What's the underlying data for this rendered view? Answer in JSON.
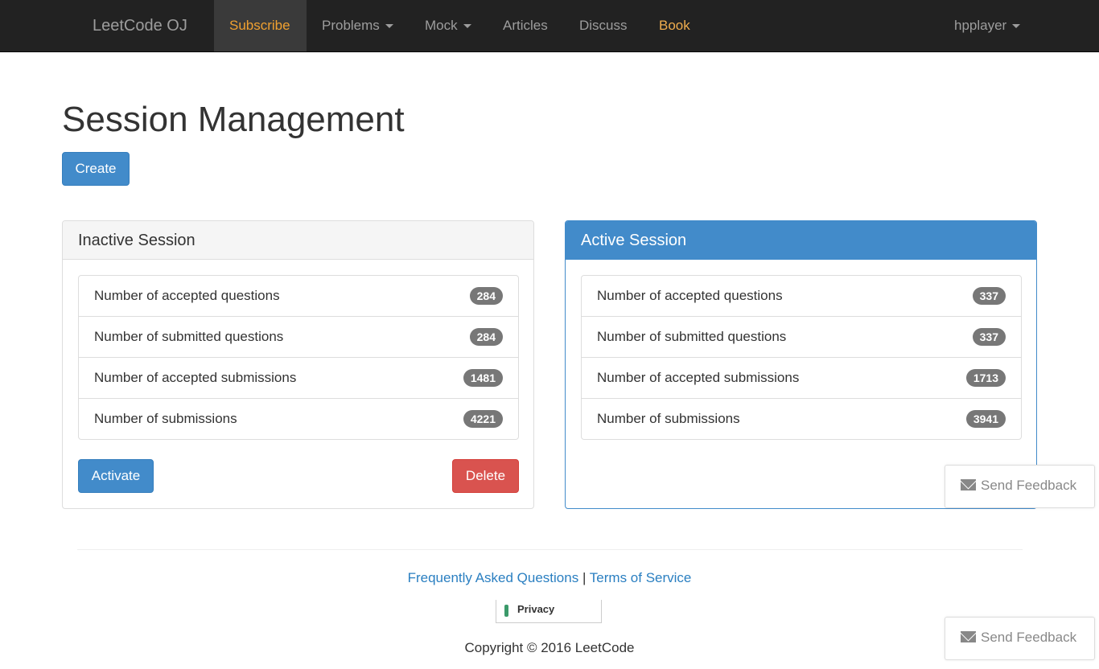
{
  "navbar": {
    "brand": "LeetCode OJ",
    "items": [
      {
        "label": "Subscribe"
      },
      {
        "label": "Problems"
      },
      {
        "label": "Mock"
      },
      {
        "label": "Articles"
      },
      {
        "label": "Discuss"
      },
      {
        "label": "Book"
      }
    ],
    "user": "hpplayer"
  },
  "page": {
    "title": "Session Management",
    "create_label": "Create"
  },
  "inactive": {
    "heading": "Inactive Session",
    "rows": [
      {
        "label": "Number of accepted questions",
        "count": "284"
      },
      {
        "label": "Number of submitted questions",
        "count": "284"
      },
      {
        "label": "Number of accepted submissions",
        "count": "1481"
      },
      {
        "label": "Number of submissions",
        "count": "4221"
      }
    ],
    "activate_label": "Activate",
    "delete_label": "Delete"
  },
  "active": {
    "heading": "Active Session",
    "rows": [
      {
        "label": "Number of accepted questions",
        "count": "337"
      },
      {
        "label": "Number of submitted questions",
        "count": "337"
      },
      {
        "label": "Number of accepted submissions",
        "count": "1713"
      },
      {
        "label": "Number of submissions",
        "count": "3941"
      }
    ]
  },
  "feedback": {
    "label": "Send Feedback",
    "icon": "mail-icon"
  },
  "footer": {
    "faq": "Frequently Asked Questions",
    "separator": "|",
    "terms": "Terms of Service",
    "privacy": "Privacy",
    "copyright": "Copyright © 2016 LeetCode"
  },
  "colors": {
    "navbar": "#222222",
    "primary": "#428bca",
    "danger": "#d9534f",
    "badge": "#777777",
    "accent_orange": "#f0ad4e"
  }
}
